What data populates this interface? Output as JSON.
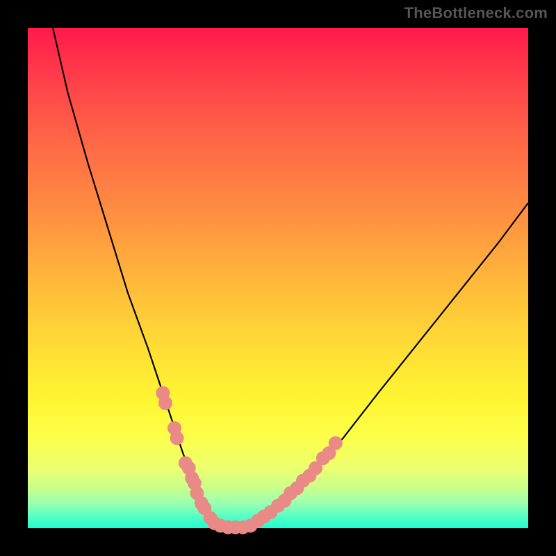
{
  "watermark": "TheBottleneck.com",
  "colors": {
    "bg": "#000000",
    "curve": "#000000",
    "marker": "#e98a86",
    "gradient_top": "#ff1a4b",
    "gradient_bottom": "#1affd0"
  },
  "chart_data": {
    "type": "line",
    "title": "",
    "xlabel": "",
    "ylabel": "",
    "xlim": [
      0,
      100
    ],
    "ylim": [
      0,
      100
    ],
    "grid": false,
    "series": [
      {
        "name": "curve",
        "x": [
          5,
          8,
          12,
          16,
          20,
          24,
          27,
          29,
          31,
          33,
          34.5,
          36,
          38,
          41,
          45,
          50,
          56,
          63,
          70,
          78,
          86,
          94,
          100
        ],
        "y": [
          100,
          87,
          73,
          60,
          47,
          36,
          27,
          21,
          15,
          10,
          6,
          3,
          1,
          0,
          1,
          4,
          10,
          18,
          27,
          37,
          47,
          57,
          65
        ]
      }
    ],
    "markers": [
      {
        "x": 27.0,
        "y": 27
      },
      {
        "x": 27.5,
        "y": 25
      },
      {
        "x": 29.3,
        "y": 20
      },
      {
        "x": 29.8,
        "y": 18
      },
      {
        "x": 31.5,
        "y": 13
      },
      {
        "x": 32.2,
        "y": 12
      },
      {
        "x": 32.8,
        "y": 10
      },
      {
        "x": 33.3,
        "y": 9
      },
      {
        "x": 33.8,
        "y": 7
      },
      {
        "x": 34.7,
        "y": 5
      },
      {
        "x": 35.3,
        "y": 4
      },
      {
        "x": 36.5,
        "y": 2
      },
      {
        "x": 37.3,
        "y": 1
      },
      {
        "x": 38.5,
        "y": 0.5
      },
      {
        "x": 40.0,
        "y": 0.2
      },
      {
        "x": 41.5,
        "y": 0.2
      },
      {
        "x": 43.0,
        "y": 0.2
      },
      {
        "x": 44.5,
        "y": 0.5
      },
      {
        "x": 46.0,
        "y": 1.5
      },
      {
        "x": 47.2,
        "y": 2.3
      },
      {
        "x": 48.5,
        "y": 3.2
      },
      {
        "x": 50.0,
        "y": 4.5
      },
      {
        "x": 51.3,
        "y": 5.5
      },
      {
        "x": 52.5,
        "y": 7
      },
      {
        "x": 53.8,
        "y": 8
      },
      {
        "x": 55.0,
        "y": 9.5
      },
      {
        "x": 56.3,
        "y": 10.5
      },
      {
        "x": 57.5,
        "y": 12
      },
      {
        "x": 59.0,
        "y": 14
      },
      {
        "x": 60.2,
        "y": 15
      },
      {
        "x": 61.5,
        "y": 17
      }
    ]
  }
}
